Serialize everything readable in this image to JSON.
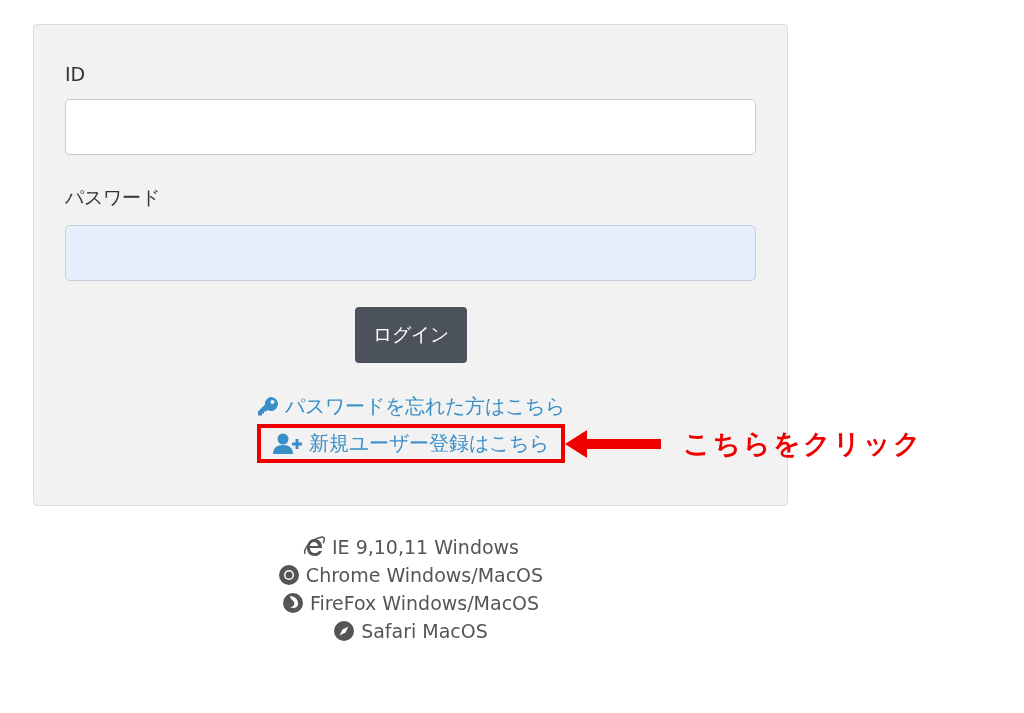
{
  "form": {
    "fields": [
      {
        "label": "ID",
        "autofilled": false
      },
      {
        "label": "パスワード",
        "autofilled": true
      }
    ],
    "login_button": "ログイン",
    "links": [
      {
        "kind": "key",
        "text": "パスワードを忘れた方はこちら",
        "highlighted": false
      },
      {
        "kind": "user-plus",
        "text": "新規ユーザー登録はこちら",
        "highlighted": true
      }
    ]
  },
  "callout": "こちらをクリック",
  "browsers": [
    {
      "kind": "ie",
      "text": "IE 9,10,11 Windows"
    },
    {
      "kind": "chrome",
      "text": "Chrome Windows/MacOS"
    },
    {
      "kind": "firefox",
      "text": "FireFox Windows/MacOS"
    },
    {
      "kind": "safari",
      "text": "Safari MacOS"
    }
  ]
}
